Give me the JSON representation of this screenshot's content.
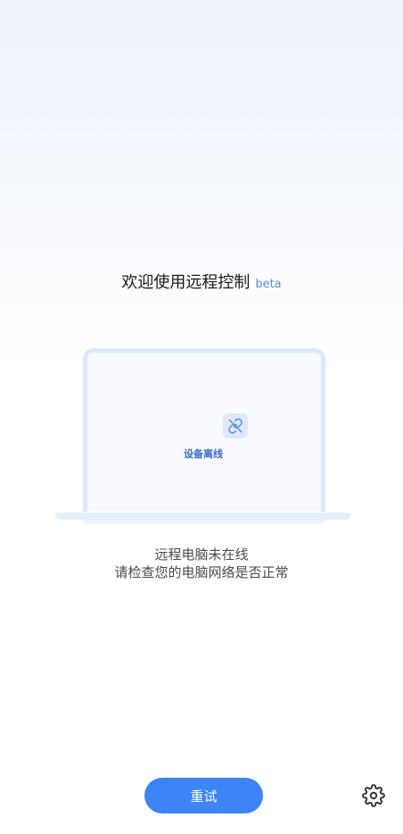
{
  "header": {
    "title": "欢迎使用远程控制",
    "badge": "beta"
  },
  "device": {
    "status_label": "设备离线",
    "status_icon": "link-off-icon"
  },
  "message": {
    "line1": "远程电脑未在线",
    "line2": "请检查您的电脑网络是否正常"
  },
  "actions": {
    "retry_label": "重试",
    "settings_icon": "gear-icon"
  },
  "colors": {
    "accent": "#3d84f7",
    "beta": "#5a8fd6",
    "laptop_frame": "#dbe8fb"
  }
}
